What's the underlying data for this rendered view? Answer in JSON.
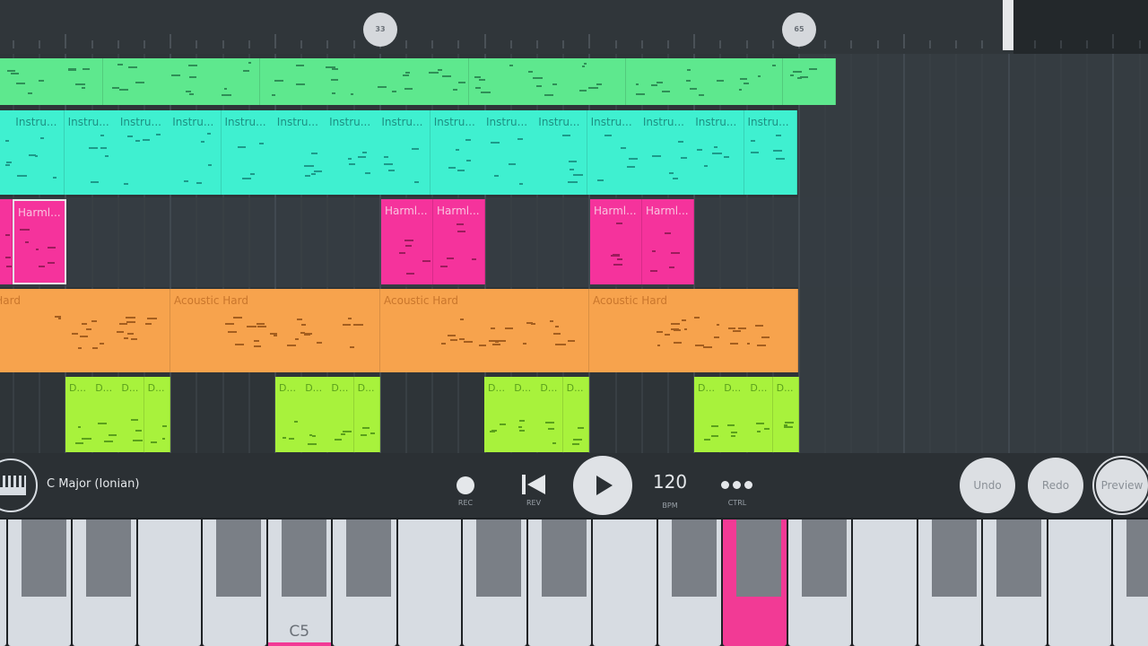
{
  "ruler": {
    "markers": [
      "33",
      "65"
    ]
  },
  "tracks": {
    "instrument_clip_label": "Instru...",
    "harmony_clip_label": "Harml...",
    "acoustic_clip_label": "Acoustic Hard",
    "drum_clip_label": "D..."
  },
  "transport": {
    "scale_label": "C Major (Ionian)",
    "rec_label": "REC",
    "rev_label": "REV",
    "bpm_value": "120",
    "bpm_label": "BPM",
    "ctrl_label": "CTRL",
    "undo_label": "Undo",
    "redo_label": "Redo",
    "preview_label": "Preview"
  },
  "keyboard": {
    "octave_label": "C5"
  },
  "colors": {
    "green_track": "#5ee88e",
    "teal_track": "#3ff0d0",
    "pink_track": "#f5339c",
    "orange_track": "#f7a34d",
    "lime_track": "#a8f23c",
    "pressed_key": "#f23a95"
  }
}
